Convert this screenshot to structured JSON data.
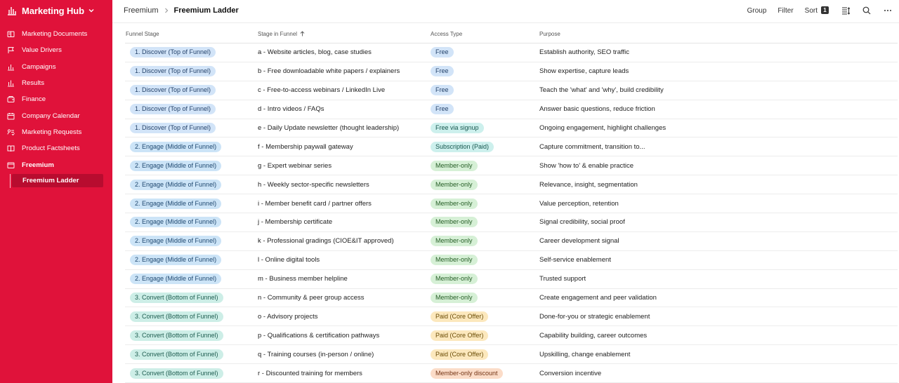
{
  "app": {
    "title": "Marketing Hub"
  },
  "sidebar": {
    "items": [
      {
        "label": "Marketing Documents",
        "icon": "document-stack-icon"
      },
      {
        "label": "Value Drivers",
        "icon": "flag-icon"
      },
      {
        "label": "Campaigns",
        "icon": "megaphone-icon"
      },
      {
        "label": "Results",
        "icon": "chart-icon"
      },
      {
        "label": "Finance",
        "icon": "wallet-icon"
      },
      {
        "label": "Company Calendar",
        "icon": "calendar-icon"
      },
      {
        "label": "Marketing Requests",
        "icon": "request-icon"
      },
      {
        "label": "Product Factsheets",
        "icon": "book-icon"
      },
      {
        "label": "Freemium",
        "icon": "window-icon"
      }
    ],
    "sub_item": "Freemium Ladder"
  },
  "breadcrumb": {
    "parent": "Freemium",
    "current": "Freemium Ladder"
  },
  "toolbar": {
    "group_label": "Group",
    "filter_label": "Filter",
    "sort_label": "Sort",
    "sort_count": "1"
  },
  "table": {
    "columns": [
      "Funnel Stage",
      "Stage in Funnel",
      "Access Type",
      "Purpose"
    ],
    "rows": [
      {
        "funnel": "1. Discover (Top of Funnel)",
        "funnel_kind": "discover",
        "stage": "a - Website articles, blog, case studies",
        "access": "Free",
        "access_kind": "free",
        "purpose": "Establish authority, SEO traffic"
      },
      {
        "funnel": "1. Discover (Top of Funnel)",
        "funnel_kind": "discover",
        "stage": "b - Free downloadable white papers / explainers",
        "access": "Free",
        "access_kind": "free",
        "purpose": "Show expertise, capture leads"
      },
      {
        "funnel": "1. Discover (Top of Funnel)",
        "funnel_kind": "discover",
        "stage": "c - Free-to-access webinars / LinkedIn Live",
        "access": "Free",
        "access_kind": "free",
        "purpose": "Teach the 'what' and 'why', build credibility"
      },
      {
        "funnel": "1. Discover (Top of Funnel)",
        "funnel_kind": "discover",
        "stage": "d - Intro videos / FAQs",
        "access": "Free",
        "access_kind": "free",
        "purpose": "Answer basic questions, reduce friction"
      },
      {
        "funnel": "1. Discover (Top of Funnel)",
        "funnel_kind": "discover",
        "stage": "e - Daily Update newsletter (thought leadership)",
        "access": "Free via signup",
        "access_kind": "signup",
        "purpose": "Ongoing engagement, highlight challenges"
      },
      {
        "funnel": "2. Engage (Middle of Funnel)",
        "funnel_kind": "engage",
        "stage": "f - Membership paywall gateway",
        "access": "Subscription (Paid)",
        "access_kind": "sub",
        "purpose": "Capture commitment, transition to..."
      },
      {
        "funnel": "2. Engage (Middle of Funnel)",
        "funnel_kind": "engage",
        "stage": "g - Expert webinar series",
        "access": "Member-only",
        "access_kind": "member",
        "purpose": "Show 'how to' & enable practice"
      },
      {
        "funnel": "2. Engage (Middle of Funnel)",
        "funnel_kind": "engage",
        "stage": "h - Weekly sector-specific newsletters",
        "access": "Member-only",
        "access_kind": "member",
        "purpose": "Relevance, insight, segmentation"
      },
      {
        "funnel": "2. Engage (Middle of Funnel)",
        "funnel_kind": "engage",
        "stage": "i - Member benefit card / partner offers",
        "access": "Member-only",
        "access_kind": "member",
        "purpose": "Value perception, retention"
      },
      {
        "funnel": "2. Engage (Middle of Funnel)",
        "funnel_kind": "engage",
        "stage": "j - Membership certificate",
        "access": "Member-only",
        "access_kind": "member",
        "purpose": "Signal credibility, social proof"
      },
      {
        "funnel": "2. Engage (Middle of Funnel)",
        "funnel_kind": "engage",
        "stage": "k - Professional gradings (CIOE&IT approved)",
        "access": "Member-only",
        "access_kind": "member",
        "purpose": "Career development signal"
      },
      {
        "funnel": "2. Engage (Middle of Funnel)",
        "funnel_kind": "engage",
        "stage": "l - Online digital tools",
        "access": "Member-only",
        "access_kind": "member",
        "purpose": "Self-service enablement"
      },
      {
        "funnel": "2. Engage (Middle of Funnel)",
        "funnel_kind": "engage",
        "stage": "m - Business member helpline",
        "access": "Member-only",
        "access_kind": "member",
        "purpose": "Trusted support"
      },
      {
        "funnel": "3. Convert (Bottom of Funnel)",
        "funnel_kind": "convert",
        "stage": "n - Community & peer group access",
        "access": "Member-only",
        "access_kind": "member",
        "purpose": "Create engagement and peer validation"
      },
      {
        "funnel": "3. Convert (Bottom of Funnel)",
        "funnel_kind": "convert",
        "stage": "o - Advisory projects",
        "access": "Paid (Core Offer)",
        "access_kind": "paid",
        "purpose": "Done-for-you or strategic enablement"
      },
      {
        "funnel": "3. Convert (Bottom of Funnel)",
        "funnel_kind": "convert",
        "stage": "p - Qualifications & certification pathways",
        "access": "Paid (Core Offer)",
        "access_kind": "paid",
        "purpose": "Capability building, career outcomes"
      },
      {
        "funnel": "3. Convert (Bottom of Funnel)",
        "funnel_kind": "convert",
        "stage": "q - Training courses (in-person / online)",
        "access": "Paid (Core Offer)",
        "access_kind": "paid",
        "purpose": "Upskilling, change enablement"
      },
      {
        "funnel": "3. Convert (Bottom of Funnel)",
        "funnel_kind": "convert",
        "stage": "r - Discounted training for members",
        "access": "Member-only discount",
        "access_kind": "discount",
        "purpose": "Conversion incentive"
      }
    ]
  },
  "colors": {
    "sidebar_bg": "#e0123a",
    "sidebar_active": "#b80c2f"
  }
}
